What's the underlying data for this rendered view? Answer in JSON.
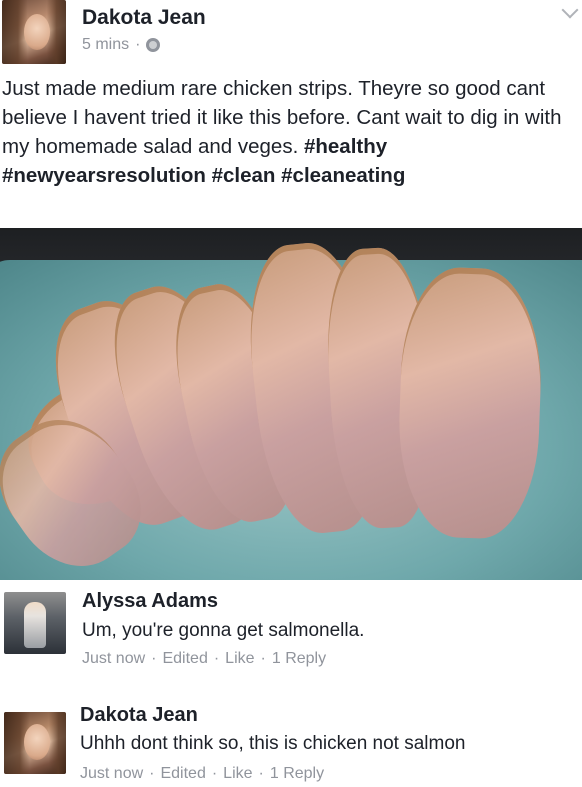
{
  "post": {
    "author": "Dakota Jean",
    "time": "5 mins",
    "separator": "·",
    "text_main": "Just made medium rare chicken strips. Theyre so good cant believe I havent tried it like this before. Cant wait to dig in with my homemade salad and veges.",
    "text_hashtags": "#healthy #newyearsresolution #clean #cleaneating"
  },
  "comments": [
    {
      "author": "Alyssa Adams",
      "text": "Um, you're gonna get salmonella.",
      "time": "Just now",
      "edited": "Edited",
      "like": "Like",
      "reply": "1 Reply",
      "sep": "·"
    },
    {
      "author": "Dakota Jean",
      "text": "Uhhh dont think so, this is chicken not salmon",
      "time": "Just now",
      "edited": "Edited",
      "like": "Like",
      "reply": "1 Reply",
      "sep": "·"
    }
  ],
  "icons": {
    "privacy": "globe-icon",
    "options": "chevron-down-icon"
  }
}
